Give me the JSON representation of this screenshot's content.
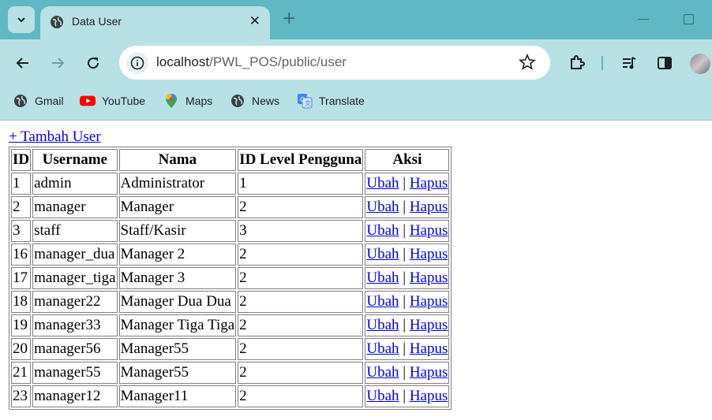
{
  "browser": {
    "tab_title": "Data User",
    "url_host": "localhost",
    "url_path": "/PWL_POS/public/user",
    "bookmarks": [
      {
        "label": "Gmail",
        "icon": "globe-icon"
      },
      {
        "label": "YouTube",
        "icon": "youtube-icon"
      },
      {
        "label": "Maps",
        "icon": "maps-icon"
      },
      {
        "label": "News",
        "icon": "globe-icon"
      },
      {
        "label": "Translate",
        "icon": "translate-icon"
      }
    ],
    "colors": {
      "frame": "#5fb8c3",
      "toolbar": "#b8e1e5"
    }
  },
  "page": {
    "add_link": "+ Tambah User",
    "table": {
      "headers": [
        "ID",
        "Username",
        "Nama",
        "ID Level Pengguna",
        "Aksi"
      ],
      "edit_label": "Ubah",
      "action_separator": "|",
      "delete_label": "Hapus",
      "rows": [
        {
          "id": "1",
          "username": "admin",
          "nama": "Administrator",
          "level": "1"
        },
        {
          "id": "2",
          "username": "manager",
          "nama": "Manager",
          "level": "2"
        },
        {
          "id": "3",
          "username": "staff",
          "nama": "Staff/Kasir",
          "level": "3"
        },
        {
          "id": "16",
          "username": "manager_dua",
          "nama": "Manager 2",
          "level": "2"
        },
        {
          "id": "17",
          "username": "manager_tiga",
          "nama": "Manager 3",
          "level": "2"
        },
        {
          "id": "18",
          "username": "manager22",
          "nama": "Manager Dua Dua",
          "level": "2"
        },
        {
          "id": "19",
          "username": "manager33",
          "nama": "Manager Tiga Tiga",
          "level": "2"
        },
        {
          "id": "20",
          "username": "manager56",
          "nama": "Manager55",
          "level": "2"
        },
        {
          "id": "21",
          "username": "manager55",
          "nama": "Manager55",
          "level": "2"
        },
        {
          "id": "23",
          "username": "manager12",
          "nama": "Manager11",
          "level": "2"
        }
      ]
    }
  }
}
